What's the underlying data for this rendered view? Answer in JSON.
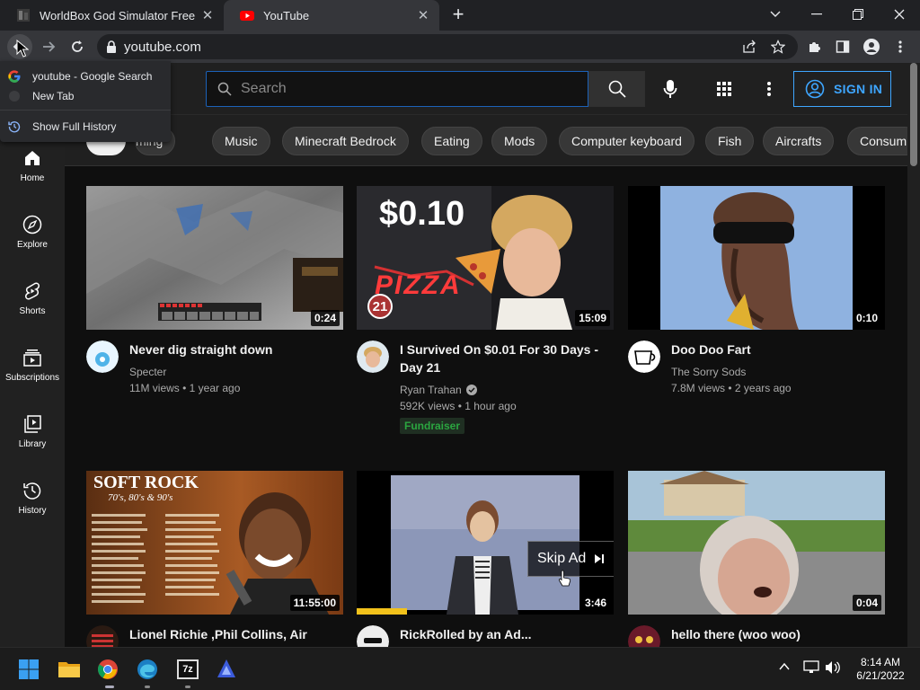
{
  "browser": {
    "tabs": [
      {
        "title": "WorldBox God Simulator Free Do",
        "active": false
      },
      {
        "title": "YouTube",
        "active": true
      }
    ],
    "url": "youtube.com"
  },
  "history_popup": {
    "items": [
      {
        "label": "youtube - Google Search",
        "icon": "google-icon"
      },
      {
        "label": "New Tab",
        "icon": "blank-page-icon"
      },
      {
        "label": "Show Full History",
        "icon": "history-icon"
      }
    ]
  },
  "youtube": {
    "search": {
      "placeholder": "Search"
    },
    "signin_label": "SIGN IN",
    "chips": [
      "ming",
      "Music",
      "Minecraft Bedrock",
      "Eating",
      "Mods",
      "Computer keyboard",
      "Fish",
      "Aircrafts",
      "Consum"
    ],
    "sidebar": [
      {
        "label": "Home",
        "icon": "home-icon"
      },
      {
        "label": "Explore",
        "icon": "compass-icon"
      },
      {
        "label": "Shorts",
        "icon": "shorts-icon"
      },
      {
        "label": "Subscriptions",
        "icon": "subscriptions-icon"
      },
      {
        "label": "Library",
        "icon": "library-icon"
      },
      {
        "label": "History",
        "icon": "history-icon"
      }
    ],
    "videos": [
      {
        "title_line1": "Never dig straight down",
        "title_line2": "",
        "channel": "Specter",
        "verified": false,
        "meta": "11M views • 1 year ago",
        "duration": "0:24",
        "badge": ""
      },
      {
        "title_line1": "I Survived On $0.01 For 30 Days -",
        "title_line2": "Day 21",
        "channel": "Ryan Trahan",
        "verified": true,
        "meta": "592K views • 1 hour ago",
        "duration": "15:09",
        "badge": "Fundraiser",
        "thumb_price": "$0.10",
        "thumb_sign": "PIZZA",
        "thumb_day": "21"
      },
      {
        "title_line1": "Doo Doo Fart",
        "title_line2": "",
        "channel": "The Sorry Sods",
        "verified": false,
        "meta": "7.8M views • 2 years ago",
        "duration": "0:10",
        "badge": ""
      },
      {
        "title_line1": "Lionel Richie ,Phil Collins, Air",
        "title_line2": "",
        "channel": "",
        "meta": "",
        "duration": "11:55:00",
        "thumb_title": "SOFT ROCK",
        "thumb_subtitle": "70's, 80's & 90's"
      },
      {
        "title_line1": "RickRolled by an Ad...",
        "title_line2": "",
        "channel": "",
        "meta": "",
        "duration": "3:46",
        "skip_ad": "Skip Ad"
      },
      {
        "title_line1": "hello there (woo woo)",
        "title_line2": "",
        "channel": "",
        "meta": "",
        "duration": "0:04"
      }
    ]
  },
  "taskbar": {
    "time": "8:14 AM",
    "date": "6/21/2022",
    "apps": [
      "windows-start-icon",
      "file-explorer-icon",
      "chrome-icon",
      "edge-icon",
      "7zip-icon",
      "app-icon"
    ]
  },
  "colors": {
    "accent": "#3ea6ff",
    "youtube_red": "#ff0000",
    "fundraiser_green": "#2ba640"
  }
}
